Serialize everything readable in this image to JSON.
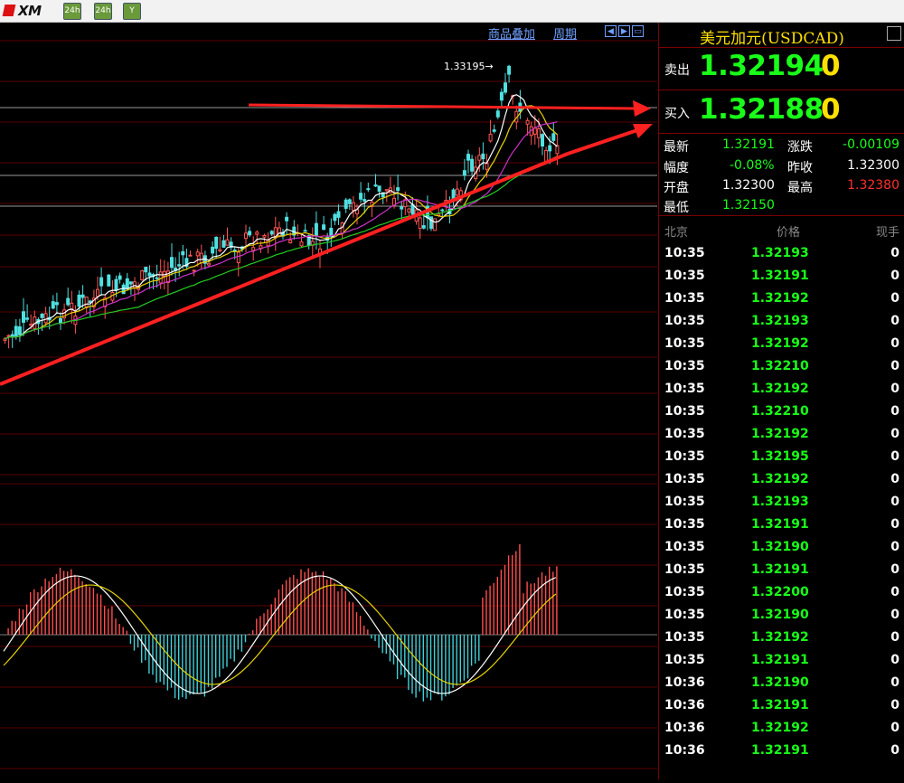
{
  "toolbar": {
    "logo_text": "XM",
    "buttons": [
      {
        "icon": "chart-24h-icon",
        "label": "24h"
      },
      {
        "icon": "chart-icon",
        "label": "24h"
      },
      {
        "icon": "filter-icon",
        "label": "Y"
      }
    ]
  },
  "chart": {
    "links": [
      "商品叠加",
      "周期"
    ],
    "high_annotation": "1.33195→",
    "nav_buttons": [
      "arrow-left-icon",
      "arrow-right-icon",
      "zoom-icon"
    ]
  },
  "chart_data": {
    "type": "candlestick",
    "symbol": "USDCAD",
    "marked_high": 1.33195,
    "trendlines": [
      "ascending support line (red)",
      "horizontal resistance line (red)"
    ],
    "indicator": "MACD histogram with signal lines"
  },
  "panel": {
    "title": "美元加元(USDCAD)",
    "sell": {
      "label": "卖出",
      "price": "1.32194",
      "volume": "0"
    },
    "buy": {
      "label": "买入",
      "price": "1.32188",
      "volume": "0"
    },
    "stats": {
      "latest_label": "最新",
      "latest": "1.32191",
      "change_label": "涨跌",
      "change": "-0.00109",
      "range_label": "幅度",
      "range": "-0.08%",
      "prev_close_label": "昨收",
      "prev_close": "1.32300",
      "open_label": "开盘",
      "open": "1.32300",
      "high_label": "最高",
      "high": "1.32380",
      "low_label": "最低",
      "low": "1.32150"
    },
    "tick_header": {
      "time": "北京",
      "price": "价格",
      "volume": "现手"
    },
    "ticks": [
      {
        "time": "10:35",
        "price": "1.32193",
        "vol": "0"
      },
      {
        "time": "10:35",
        "price": "1.32191",
        "vol": "0"
      },
      {
        "time": "10:35",
        "price": "1.32192",
        "vol": "0"
      },
      {
        "time": "10:35",
        "price": "1.32193",
        "vol": "0"
      },
      {
        "time": "10:35",
        "price": "1.32192",
        "vol": "0"
      },
      {
        "time": "10:35",
        "price": "1.32210",
        "vol": "0"
      },
      {
        "time": "10:35",
        "price": "1.32192",
        "vol": "0"
      },
      {
        "time": "10:35",
        "price": "1.32210",
        "vol": "0"
      },
      {
        "time": "10:35",
        "price": "1.32192",
        "vol": "0"
      },
      {
        "time": "10:35",
        "price": "1.32195",
        "vol": "0"
      },
      {
        "time": "10:35",
        "price": "1.32192",
        "vol": "0"
      },
      {
        "time": "10:35",
        "price": "1.32193",
        "vol": "0"
      },
      {
        "time": "10:35",
        "price": "1.32191",
        "vol": "0"
      },
      {
        "time": "10:35",
        "price": "1.32190",
        "vol": "0"
      },
      {
        "time": "10:35",
        "price": "1.32191",
        "vol": "0"
      },
      {
        "time": "10:35",
        "price": "1.32200",
        "vol": "0"
      },
      {
        "time": "10:35",
        "price": "1.32190",
        "vol": "0"
      },
      {
        "time": "10:35",
        "price": "1.32192",
        "vol": "0"
      },
      {
        "time": "10:35",
        "price": "1.32191",
        "vol": "0"
      },
      {
        "time": "10:36",
        "price": "1.32190",
        "vol": "0"
      },
      {
        "time": "10:36",
        "price": "1.32191",
        "vol": "0"
      },
      {
        "time": "10:36",
        "price": "1.32192",
        "vol": "0"
      },
      {
        "time": "10:36",
        "price": "1.32191",
        "vol": "0"
      }
    ],
    "colors": {
      "up": "#19ff19",
      "down": "#ff3030",
      "accent": "#ffe000"
    }
  }
}
